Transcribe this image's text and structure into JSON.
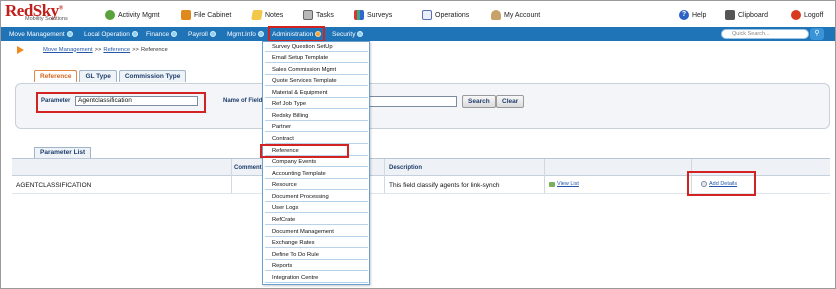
{
  "logo": {
    "brand": "RedSky",
    "reg": "®",
    "subtitle": "Mobility Solutions"
  },
  "top_nav": [
    {
      "label": "Activity Mgmt",
      "icon": "activity-icon"
    },
    {
      "label": "File Cabinet",
      "icon": "file-cabinet-icon"
    },
    {
      "label": "Notes",
      "icon": "notes-icon"
    },
    {
      "label": "Tasks",
      "icon": "tasks-icon"
    },
    {
      "label": "Surveys",
      "icon": "surveys-icon"
    },
    {
      "label": "Operations",
      "icon": "operations-icon"
    },
    {
      "label": "My Account",
      "icon": "my-account-icon"
    },
    {
      "label": "Help",
      "icon": "help-icon"
    },
    {
      "label": "Clipboard",
      "icon": "clipboard-icon"
    },
    {
      "label": "Logoff",
      "icon": "logoff-icon"
    }
  ],
  "main_menu": [
    {
      "label": "Move Management"
    },
    {
      "label": "Local Operation"
    },
    {
      "label": "Finance"
    },
    {
      "label": "Payroll"
    },
    {
      "label": "Mgmt.Info"
    },
    {
      "label": "Administration",
      "active": true
    },
    {
      "label": "Security"
    }
  ],
  "quick_search": {
    "placeholder": "Quick Search..."
  },
  "breadcrumb": {
    "link1": "Move Management",
    "sep1": ">>",
    "link2": "Reference",
    "sep2": ">>",
    "current": "Reference"
  },
  "tabs": [
    {
      "label": "Reference",
      "active": true
    },
    {
      "label": "GL Type"
    },
    {
      "label": "Commission Type"
    }
  ],
  "search_form": {
    "parameter_label": "Parameter",
    "parameter_value": "Agentclassification",
    "name_label": "Name of Field",
    "search_button": "Search",
    "clear_button": "Clear"
  },
  "list": {
    "tab_label": "Parameter List",
    "columns": [
      "Comment",
      "Description"
    ],
    "rows": [
      {
        "parameter": "AGENTCLASSIFICATION",
        "description": "This field classify agents for link-synch",
        "view_link": "View List",
        "add_link": "Add Details"
      }
    ]
  },
  "admin_dropdown": {
    "items": [
      "Survey Question SetUp",
      "Email Setup Template",
      "Sales Commission Mgmt",
      "Quote Services Template",
      "Material & Equipment",
      "Ref Job Type",
      "Redsky Billing",
      "Partner",
      "Contract",
      "Reference",
      "Company Events",
      "Accounting Template",
      "Resource",
      "Document Processing",
      "User Logs",
      "RefCrate",
      "Document Management",
      "Exchange Rates",
      "Define To Do Rule",
      "Reports",
      "Integration Centre"
    ],
    "highlighted": "Reference"
  },
  "colors": {
    "nav_blue": "#1f73b7",
    "highlight_red": "#d32222",
    "brand_red": "#c0201c",
    "tab_orange": "#d9651d"
  }
}
